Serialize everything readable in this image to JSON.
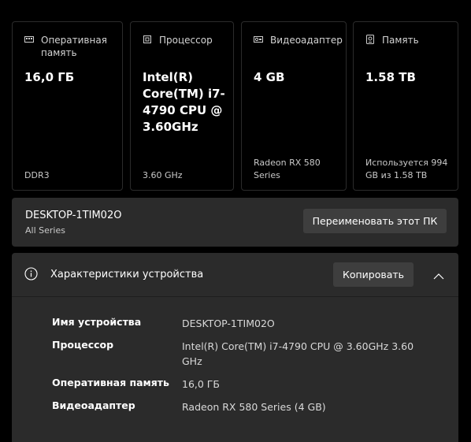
{
  "cards": [
    {
      "label": "Оперативная память",
      "value": "16,0 ГБ",
      "foot": "DDR3",
      "icon": "ram-icon"
    },
    {
      "label": "Процессор",
      "value": "Intel(R) Core(TM) i7-4790 CPU @ 3.60GHz",
      "foot": "3.60 GHz",
      "icon": "cpu-icon"
    },
    {
      "label": "Видеоадаптер",
      "value": "4 GB",
      "foot": "Radeon RX 580 Series",
      "icon": "gpu-icon"
    },
    {
      "label": "Память",
      "value": "1.58 TB",
      "foot": "Используется 994 GB из 1.58 TB",
      "icon": "storage-icon"
    }
  ],
  "device": {
    "name": "DESKTOP-1TIM02O",
    "model": "All Series",
    "rename_label": "Переименовать этот ПК"
  },
  "specs": {
    "title": "Характеристики устройства",
    "copy_label": "Копировать",
    "rows": [
      {
        "key": "Имя устройства",
        "value": "DESKTOP-1TIM02O"
      },
      {
        "key": "Процессор",
        "value": "Intel(R) Core(TM) i7-4790 CPU @ 3.60GHz   3.60 GHz"
      },
      {
        "key": "Оперативная память",
        "value": "16,0 ГБ"
      },
      {
        "key": "Видеоадаптер",
        "value": "Radeon RX 580 Series (4 GB)"
      }
    ]
  },
  "colors": {
    "background": "#000000",
    "panel": "#2b2b2b",
    "button": "#3e3e3e",
    "card_border": "#2b2b2b"
  }
}
